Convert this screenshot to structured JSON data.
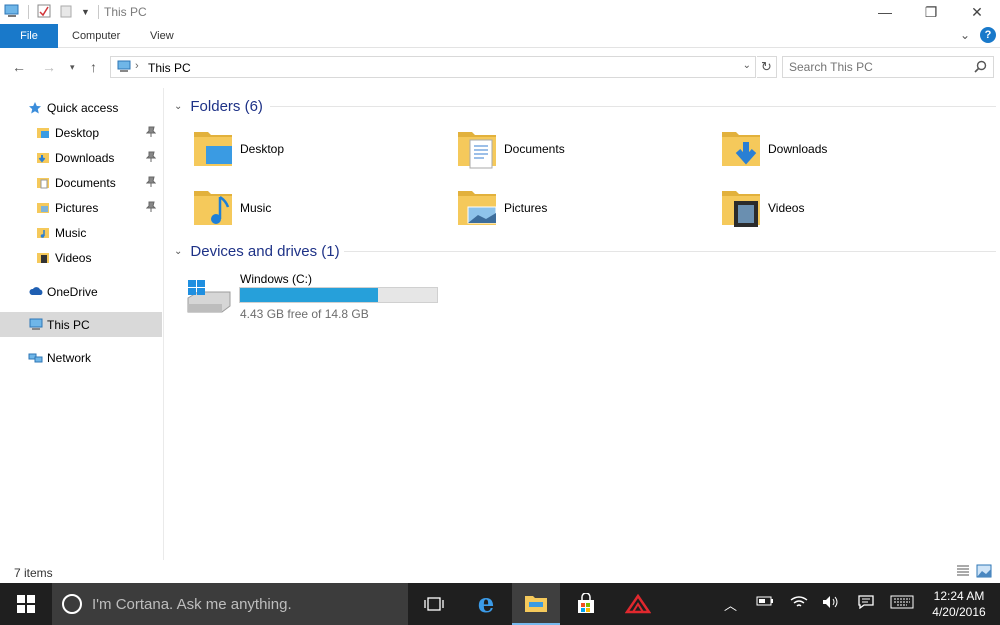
{
  "window": {
    "title": "This PC",
    "minimize": "—",
    "restore": "❐",
    "close": "✕"
  },
  "ribbon": {
    "tabs": [
      "File",
      "Computer",
      "View"
    ]
  },
  "address": {
    "location": "This PC",
    "search_placeholder": "Search This PC"
  },
  "nav": {
    "quick_access": "Quick access",
    "quick_items": [
      "Desktop",
      "Downloads",
      "Documents",
      "Pictures",
      "Music",
      "Videos"
    ],
    "onedrive": "OneDrive",
    "this_pc": "This PC",
    "network": "Network"
  },
  "folders": {
    "heading": "Folders (6)",
    "items": [
      "Desktop",
      "Documents",
      "Downloads",
      "Music",
      "Pictures",
      "Videos"
    ]
  },
  "drives": {
    "heading": "Devices and drives (1)",
    "items": [
      {
        "name": "Windows (C:)",
        "free": "4.43 GB free of 14.8 GB",
        "used_fraction": 0.7
      }
    ]
  },
  "status": {
    "count": "7 items"
  },
  "taskbar": {
    "cortana_placeholder": "I'm Cortana. Ask me anything.",
    "time": "12:24 AM",
    "date": "4/20/2016"
  },
  "colors": {
    "accent": "#1979ca",
    "drive_bar": "#26a0da",
    "folder": "#f5c95b",
    "heading": "#1e3287"
  }
}
